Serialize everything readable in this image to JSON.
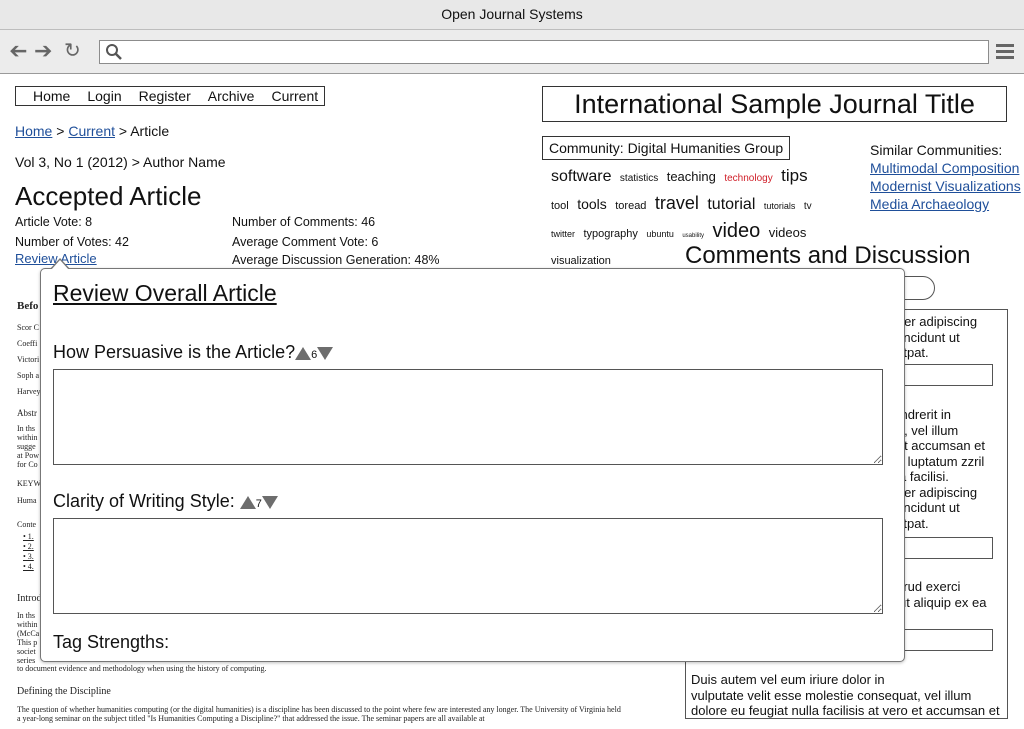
{
  "window": {
    "title": "Open Journal Systems"
  },
  "toolbar": {
    "back_icon": "back-arrow-icon",
    "forward_icon": "forward-arrow-icon",
    "reload_icon": "reload-icon",
    "search_icon": "search-icon",
    "menu_icon": "hamburger-menu-icon"
  },
  "nav": {
    "items": [
      "Home",
      "Login",
      "Register",
      "Archive",
      "Current"
    ]
  },
  "journal": {
    "title": "International Sample Journal Title"
  },
  "breadcrumb": {
    "home": "Home",
    "current": "Current",
    "separator": ">",
    "page": "Article"
  },
  "issue": {
    "line": "Vol 3, No 1 (2012) > Author Name"
  },
  "article": {
    "heading": "Accepted Article",
    "vote": "Article Vote: 8",
    "num_votes": "Number of Votes: 42",
    "review_link": "Review Article",
    "num_comments": "Number of Comments: 46",
    "avg_comment_vote": "Average Comment Vote: 6",
    "avg_discussion": "Average Discussion Generation: 48%"
  },
  "community": {
    "label": "Community: Digital Humanities Group",
    "tags": [
      {
        "text": "software",
        "size": 16,
        "color": "#111111"
      },
      {
        "text": "statistics",
        "size": 10,
        "color": "#111111"
      },
      {
        "text": "teaching",
        "size": 13,
        "color": "#111111"
      },
      {
        "text": "technology",
        "size": 10,
        "color": "#d0202a"
      },
      {
        "text": "tips",
        "size": 17,
        "color": "#111111"
      },
      {
        "text": "tool",
        "size": 11,
        "color": "#111111"
      },
      {
        "text": "tools",
        "size": 14,
        "color": "#111111"
      },
      {
        "text": "toread",
        "size": 11,
        "color": "#111111"
      },
      {
        "text": "travel",
        "size": 18,
        "color": "#111111"
      },
      {
        "text": "tutorial",
        "size": 16,
        "color": "#111111"
      },
      {
        "text": "tutorials",
        "size": 9,
        "color": "#111111"
      },
      {
        "text": "tv",
        "size": 10,
        "color": "#111111"
      },
      {
        "text": "twitter",
        "size": 9,
        "color": "#111111"
      },
      {
        "text": "typography",
        "size": 11,
        "color": "#111111"
      },
      {
        "text": "ubuntu",
        "size": 9,
        "color": "#111111"
      },
      {
        "text": "usability",
        "size": 6,
        "color": "#111111"
      },
      {
        "text": "video",
        "size": 20,
        "color": "#111111"
      },
      {
        "text": "videos",
        "size": 13,
        "color": "#111111"
      },
      {
        "text": "visualization",
        "size": 11,
        "color": "#111111"
      }
    ]
  },
  "similar": {
    "heading": "Similar Communities:",
    "links": [
      "Multimodal Composition",
      "Modernist Visualizations",
      "Media Archaeology"
    ]
  },
  "comments": {
    "heading": "Comments and Discussion",
    "blocks": [
      "etuer adipiscing\nd tincidunt ut\nolutpat.",
      "hendrerit in\nuat, vel illum\no et accumsan et\nent luptatum zzril\nulla facilisi.\netuer adipiscing\nd tincidunt ut\nolutpat.",
      "ostrud exerci\nsl ut aliquip ex ea",
      "Duis autem vel eum iriure dolor in\nvulputate velit esse molestie consequat, vel illum\ndolore eu feugiat nulla facilisis at vero et accumsan et"
    ]
  },
  "bg_article": {
    "side_heading": "Befo",
    "side_lines": [
      "Scor C",
      "Coeffi",
      "Victori",
      "Soph a",
      "Harvey"
    ],
    "abstract_heading": "Abstr",
    "abstract_lines": [
      "In ths",
      "within",
      "sugge",
      "at Pow",
      "for Co"
    ],
    "keywords": "KEYW",
    "keywords_line": "Huma",
    "contents_heading": "Conte",
    "contents_items": [
      "1.",
      "2.",
      "3.",
      "4."
    ],
    "intro_heading": "Introd",
    "intro_lines": [
      "In ths",
      "within",
      "(McCa",
      "This p",
      "societ",
      "series"
    ],
    "intro_tail": "to document evidence and methodology when using the history of computing.",
    "section_heading": "Defining the Discipline",
    "section_lines": [
      "The question of whether humanities computing (or the digital humanities) is a discipline has been discussed to the point where few are interested any longer. The University of Virginia held",
      "a year-long seminar on the subject titled \"Is Humanities Computing a Discipline?\" that addressed the issue. The seminar papers are all available at"
    ]
  },
  "modal": {
    "title": "Review Overall Article",
    "questions": [
      {
        "label": "How Persuasive is the Article?",
        "score": "6"
      },
      {
        "label": "Clarity of Writing Style:",
        "score": "7"
      }
    ],
    "tag_strengths_label": "Tag Strengths:"
  }
}
